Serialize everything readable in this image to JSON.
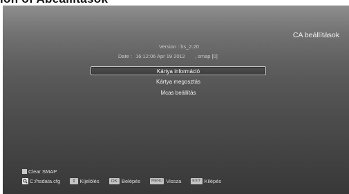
{
  "page_heading": "ion of Abeállítások",
  "screen": {
    "title": "CA beállítások",
    "version_line": "Version : hs_2.20",
    "date_label": "Date :",
    "date_value": "16:12:06 Apr 19 2012",
    "smap_value": ", smap [0]"
  },
  "menu": {
    "items": [
      {
        "label": "Kártya információ",
        "selected": true
      },
      {
        "label": "Kártya megosztás",
        "selected": false
      },
      {
        "label": "Mcas beállítás",
        "selected": false
      }
    ]
  },
  "legend": {
    "clear_smap": "Clear SMAP",
    "file_path": "C:/hsdata.cfg",
    "select_key": "⇕",
    "select_label": "Kijelölés",
    "ok_key": "OK",
    "ok_label": "Belépés",
    "menu_key": "MENU",
    "menu_label": "Vissza",
    "exit_key": "EXIT",
    "exit_label": "Kilépés"
  }
}
